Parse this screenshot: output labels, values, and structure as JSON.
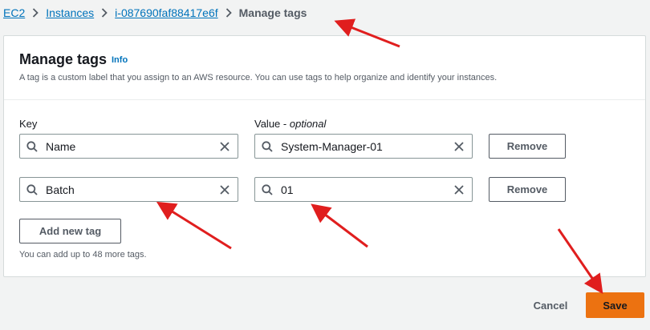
{
  "breadcrumb": {
    "items": [
      "EC2",
      "Instances",
      "i-087690faf88417e6f"
    ],
    "current": "Manage tags"
  },
  "panel": {
    "title": "Manage tags",
    "info": "Info",
    "description": "A tag is a custom label that you assign to an AWS resource. You can use tags to help organize and identify your instances."
  },
  "columns": {
    "key": "Key",
    "value": "Value",
    "value_suffix": "optional"
  },
  "tags": [
    {
      "key": "Name",
      "value": "System-Manager-01",
      "remove_label": "Remove"
    },
    {
      "key": "Batch",
      "value": "01",
      "remove_label": "Remove"
    }
  ],
  "add_tag_label": "Add new tag",
  "hint": "You can add up to 48 more tags.",
  "footer": {
    "cancel": "Cancel",
    "save": "Save"
  },
  "colors": {
    "link": "#0073bb",
    "primary": "#ec7211",
    "annotation": "#e01e1e"
  },
  "icons": [
    "search-icon",
    "clear-icon",
    "chevron-right-icon"
  ]
}
